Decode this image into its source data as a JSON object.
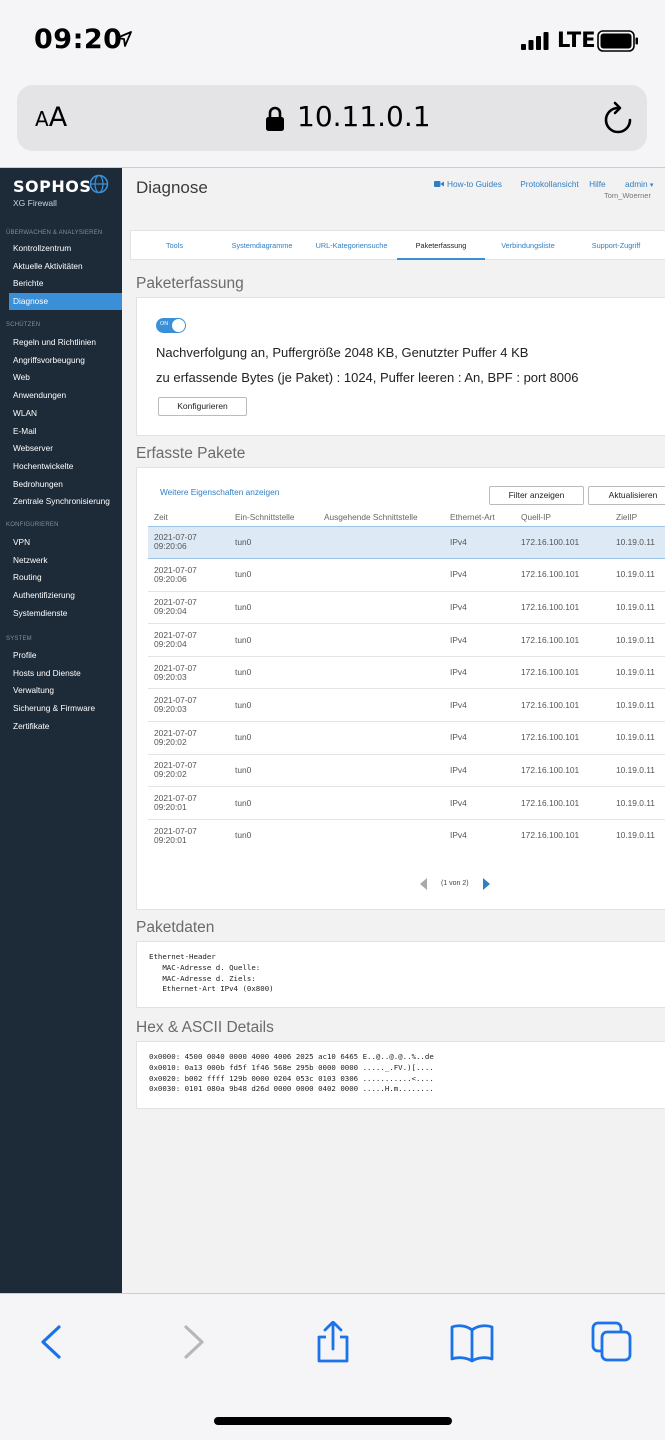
{
  "statusbar": {
    "time": "09:20",
    "network": "LTE",
    "icons": [
      "location-arrow-icon",
      "signal-bars-icon",
      "battery-icon"
    ]
  },
  "browser": {
    "text_size_label_small": "A",
    "text_size_label_big": "A",
    "url": "10.11.0.1",
    "icons": [
      "lock-icon",
      "reload-icon"
    ]
  },
  "brand": {
    "name": "SOPHOS",
    "product": "XG Firewall"
  },
  "sidebar": {
    "sections": [
      {
        "title": "ÜBERWACHEN & ANALYSIEREN",
        "items": [
          "Kontrollzentrum",
          "Aktuelle Aktivitäten",
          "Berichte",
          "Diagnose"
        ]
      },
      {
        "title": "SCHÜTZEN",
        "items": [
          "Regeln und Richtlinien",
          "Angriffsvorbeugung",
          "Web",
          "Anwendungen",
          "WLAN",
          "E-Mail",
          "Webserver",
          "Hochentwickelte",
          "Bedrohungen",
          "Zentrale Synchronisierung"
        ]
      },
      {
        "title": "KONFIGURIEREN",
        "items": [
          "VPN",
          "Netzwerk",
          "Routing",
          "Authentifizierung",
          "Systemdienste"
        ]
      },
      {
        "title": "SYSTEM",
        "items": [
          "Profile",
          "Hosts und Dienste",
          "Verwaltung",
          "Sicherung & Firmware",
          "Zertifikate"
        ]
      }
    ],
    "active": "Diagnose"
  },
  "header": {
    "title": "Diagnose",
    "howto": "How-to Guides",
    "log": "Protokollansicht",
    "help": "Hilfe",
    "admin": "admin",
    "user": "Tom_Woerner"
  },
  "tabs": [
    "Tools",
    "Systemdiagramme",
    "URL-Kategoriensuche",
    "Paketerfassung",
    "Verbindungsliste",
    "Support-Zugriff"
  ],
  "active_tab": "Paketerfassung",
  "capture": {
    "title": "Paketerfassung",
    "toggle_label": "ON",
    "toggle_on": true,
    "line1": "Nachverfolgung an, Puffergröße 2048 KB, Genutzter Puffer 4 KB",
    "line2": "zu erfassende Bytes (je Paket) : 1024, Puffer leeren : An, BPF : port 8006",
    "configure": "Konfigurieren"
  },
  "packets": {
    "title": "Erfasste Pakete",
    "more": "Weitere Eigenschaften anzeigen",
    "filter": "Filter anzeigen",
    "refresh": "Aktualisieren",
    "columns": [
      "Zeit",
      "Ein-Schnittstelle",
      "Ausgehende Schnittstelle",
      "Ethernet-Art",
      "Quell-IP",
      "ZielIP"
    ],
    "rows": [
      {
        "date": "2021-07-07",
        "time": "09:20:06",
        "in": "tun0",
        "out": "",
        "eth": "IPv4",
        "src": "172.16.100.101",
        "dst": "10.19.0.11"
      },
      {
        "date": "2021-07-07",
        "time": "09:20:06",
        "in": "tun0",
        "out": "",
        "eth": "IPv4",
        "src": "172.16.100.101",
        "dst": "10.19.0.11"
      },
      {
        "date": "2021-07-07",
        "time": "09:20:04",
        "in": "tun0",
        "out": "",
        "eth": "IPv4",
        "src": "172.16.100.101",
        "dst": "10.19.0.11"
      },
      {
        "date": "2021-07-07",
        "time": "09:20:04",
        "in": "tun0",
        "out": "",
        "eth": "IPv4",
        "src": "172.16.100.101",
        "dst": "10.19.0.11"
      },
      {
        "date": "2021-07-07",
        "time": "09:20:03",
        "in": "tun0",
        "out": "",
        "eth": "IPv4",
        "src": "172.16.100.101",
        "dst": "10.19.0.11"
      },
      {
        "date": "2021-07-07",
        "time": "09:20:03",
        "in": "tun0",
        "out": "",
        "eth": "IPv4",
        "src": "172.16.100.101",
        "dst": "10.19.0.11"
      },
      {
        "date": "2021-07-07",
        "time": "09:20:02",
        "in": "tun0",
        "out": "",
        "eth": "IPv4",
        "src": "172.16.100.101",
        "dst": "10.19.0.11"
      },
      {
        "date": "2021-07-07",
        "time": "09:20:02",
        "in": "tun0",
        "out": "",
        "eth": "IPv4",
        "src": "172.16.100.101",
        "dst": "10.19.0.11"
      },
      {
        "date": "2021-07-07",
        "time": "09:20:01",
        "in": "tun0",
        "out": "",
        "eth": "IPv4",
        "src": "172.16.100.101",
        "dst": "10.19.0.11"
      },
      {
        "date": "2021-07-07",
        "time": "09:20:01",
        "in": "tun0",
        "out": "",
        "eth": "IPv4",
        "src": "172.16.100.101",
        "dst": "10.19.0.11"
      }
    ],
    "selected_row": 0,
    "pager": "(1 von 2)"
  },
  "packet_data": {
    "title": "Paketdaten",
    "lines": [
      "Ethernet-Header",
      "   MAC-Adresse d. Quelle:",
      "   MAC-Adresse d. Ziels:",
      "   Ethernet-Art IPv4 (0x800)"
    ]
  },
  "hex": {
    "title": "Hex & ASCII Details",
    "lines": [
      "0x0000: 4500 0040 0000 4000 4006 2025 ac10 6465 E..@..@.@..%..de",
      "0x0010: 0a13 000b fd5f 1f46 568e 295b 0000 0000 ....._.FV.)[....",
      "0x0020: b002 ffff 129b 0000 0204 053c 0103 0306 ...........<....",
      "0x0030: 0101 080a 9b48 d26d 0000 0000 0402 0000 .....H.m........"
    ]
  },
  "colors": {
    "sidebar": "#1d2a38",
    "accent": "#3b8fd6",
    "link": "#2f7fc5",
    "ios_blue": "#1a73e8"
  },
  "toolbar_icons": [
    "back-icon",
    "forward-icon",
    "share-icon",
    "bookmarks-icon",
    "tabs-icon"
  ]
}
